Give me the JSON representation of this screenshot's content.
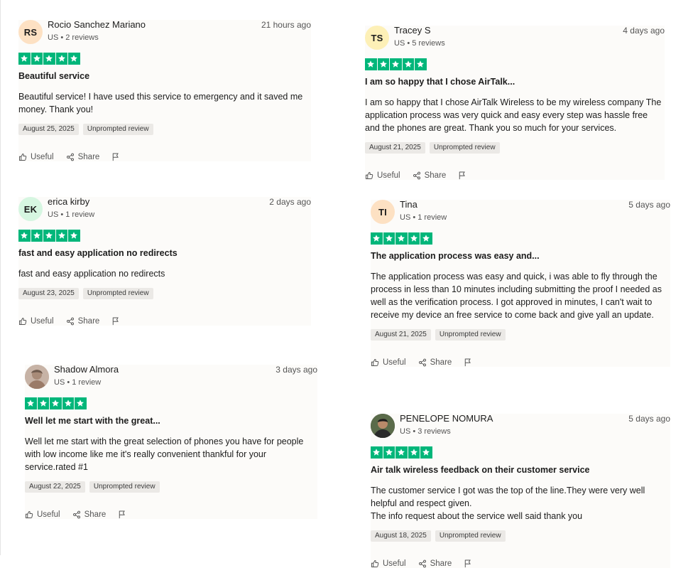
{
  "reviews": [
    {
      "initials": "RS",
      "avatar_color": "#fde1c3",
      "name": "Rocio Sanchez Mariano",
      "meta": "US • 2 reviews",
      "time": "21 hours ago",
      "rating": 5,
      "title": "Beautiful service",
      "body": "Beautiful service! I have used this service to emergency and it saved me money. Thank you!",
      "date": "August 25, 2025",
      "tag": "Unprompted review"
    },
    {
      "initials": "EK",
      "avatar_color": "#d6f6e1",
      "name": "erica kirby",
      "meta": "US • 1 review",
      "time": "2 days ago",
      "rating": 5,
      "title": "fast and easy application no redirects",
      "body": "fast and easy application no redirects",
      "date": "August 23, 2025",
      "tag": "Unprompted review"
    },
    {
      "initials": "",
      "avatar_color": "#c7b3a6",
      "avatar_icon": "user-photo-icon",
      "name": "Shadow Almora",
      "meta": "US • 1 review",
      "time": "3 days ago",
      "rating": 5,
      "title": "Well let me start with the great...",
      "body": "Well let me start with the great selection of phones you have for people with low income like me it's really convenient thankful for your service.rated #1",
      "date": "August 22, 2025",
      "tag": "Unprompted review"
    },
    {
      "initials": "TS",
      "avatar_color": "#fdf0b7",
      "name": "Tracey S",
      "meta": "US • 5 reviews",
      "time": "4 days ago",
      "rating": 5,
      "title": "I am so happy that I chose AirTalk...",
      "body": "I am so happy that I chose AirTalk Wireless to be my wireless company The application process was very quick and easy every step was hassle free and the phones are great. Thank you so much for your services.",
      "date": "August 21, 2025",
      "tag": "Unprompted review"
    },
    {
      "initials": "TI",
      "avatar_color": "#fde1c3",
      "name": "Tina",
      "meta": "US • 1 review",
      "time": "5 days ago",
      "rating": 5,
      "title": "The application process was easy and...",
      "body": "The application process was easy and quick, i was able to fly through the process in less than 10 minutes including submitting the proof I needed as well as the verification process. I got approved in minutes, I can't wait to receive my device an free service to come back and give yall an update.",
      "date": "August 21, 2025",
      "tag": "Unprompted review"
    },
    {
      "initials": "",
      "avatar_color": "#3a3530",
      "avatar_icon": "user-photo-icon",
      "name": "PENELOPE NOMURA",
      "meta": "US • 3 reviews",
      "time": "5 days ago",
      "rating": 5,
      "title": "Air talk wireless feedback on their customer service",
      "body_lines": [
        "The customer service I got was the top of the line.They were very well helpful and respect given.",
        "The info request about the service well said thank you"
      ],
      "date": "August 18, 2025",
      "tag": "Unprompted review"
    }
  ],
  "actions": {
    "useful": "Useful",
    "share": "Share"
  },
  "colors": {
    "star_green": "#00b67a"
  }
}
